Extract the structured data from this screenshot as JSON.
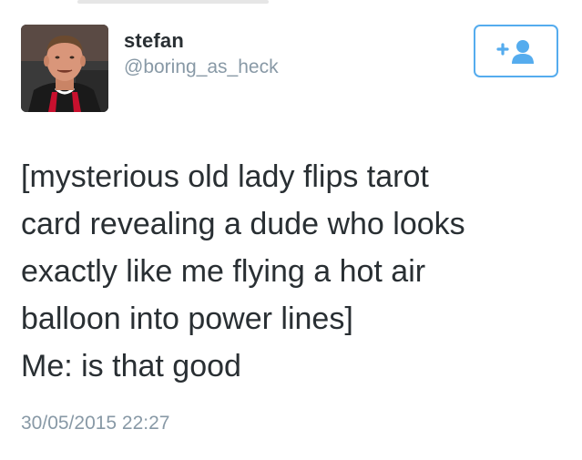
{
  "user": {
    "display_name": "stefan",
    "handle": "@boring_as_heck"
  },
  "follow_button": {
    "icon": "add-user-icon",
    "color": "#55acee"
  },
  "tweet": {
    "text_lines": [
      "[mysterious old lady flips tarot",
      "card revealing a dude who looks",
      "exactly like me flying a hot air",
      "balloon into power lines]",
      "Me: is that good"
    ],
    "timestamp": "30/05/2015 22:27"
  },
  "colors": {
    "text": "#292f33",
    "secondary": "#8899a6",
    "accent": "#55acee"
  }
}
